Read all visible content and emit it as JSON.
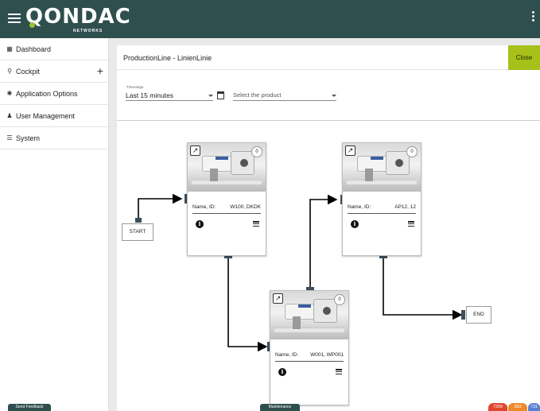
{
  "header": {
    "logo_text": "QONDAC",
    "logo_subtext": "NETWORKS",
    "brand_color": "#2f4f4f",
    "logo_accent": "#9cc42a"
  },
  "sidebar": {
    "items": [
      {
        "label": "Dashboard",
        "icon": "dashboard-icon"
      },
      {
        "label": "Cockpit",
        "icon": "search-icon",
        "expand_icon": "plus-icon"
      },
      {
        "label": "Application Options",
        "icon": "gear-icon"
      },
      {
        "label": "User Management",
        "icon": "user-icon"
      },
      {
        "label": "System",
        "icon": "list-icon"
      }
    ]
  },
  "panel": {
    "title": "ProductionLine - LinienLinie",
    "close_label": "Close",
    "close_color": "#a7c11a"
  },
  "filters": {
    "timerange_label": "Timerange",
    "timerange_value": "Last 15 minutes",
    "product_placeholder": "Select the product"
  },
  "diagram": {
    "start_label": "START",
    "end_label": "END",
    "nodes": [
      {
        "id_label": "Name, ID:",
        "id_value": "W100, DKDK",
        "count": "0"
      },
      {
        "id_label": "Name, ID:",
        "id_value": "AP12, 12",
        "count": "0"
      },
      {
        "id_label": "Name, ID:",
        "id_value": "W001, WP001",
        "count": "0"
      }
    ],
    "connector_color": "#000000",
    "port_color": "#3c4f5c"
  },
  "footer": {
    "feedback_label": "Send Feedback",
    "maintenance_label": "Maintenance",
    "status_badges": [
      {
        "value": "7309",
        "color": "#e0452f"
      },
      {
        "value": "393",
        "color": "#ef8a2b"
      },
      {
        "value": "731",
        "color": "#5b7fd0"
      }
    ]
  }
}
